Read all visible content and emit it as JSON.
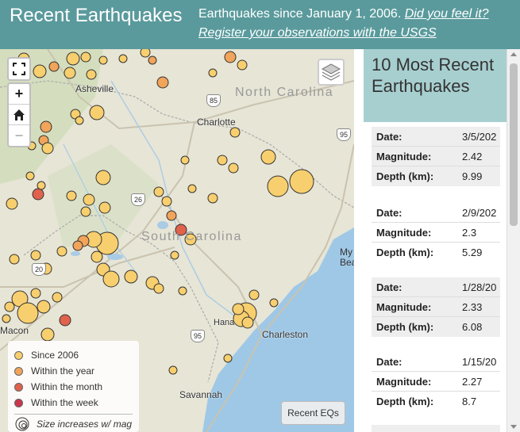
{
  "header": {
    "title": "Recent Earthquakes",
    "subtitle_text": "Earthquakes since January 1, 2006. ",
    "link1": "Did you feel it?",
    "link2": "Register your observations with the USGS"
  },
  "map": {
    "labels": {
      "asheville": "Asheville",
      "charlotte": "Charlotte",
      "north_carolina": "North Carolina",
      "south_carolina": "South Carolina",
      "charleston": "Charleston",
      "savannah": "Savannah",
      "macon": "Macon",
      "hanahan": "Hana",
      "myrtle": "My",
      "beach": "Bea"
    },
    "highways": [
      "85",
      "95",
      "26",
      "20",
      "95"
    ],
    "controls": {
      "zoom_in": "+",
      "zoom_out": "−"
    }
  },
  "legend": {
    "items": [
      {
        "label": "Since 2006",
        "color": "#f8cf6e"
      },
      {
        "label": "Within the year",
        "color": "#f1a45a"
      },
      {
        "label": "Within the month",
        "color": "#e0624c"
      },
      {
        "label": "Within the week",
        "color": "#c9364d"
      }
    ],
    "size_note": "Size increases w/ mag"
  },
  "recent_button": "Recent EQs",
  "panel": {
    "title": "10 Most Recent Earthquakes",
    "labels": {
      "date": "Date:",
      "magnitude": "Magnitude:",
      "depth": "Depth (km):"
    },
    "quakes": [
      {
        "date": "3/5/202",
        "magnitude": "2.42",
        "depth": "9.99"
      },
      {
        "date": "2/9/202",
        "magnitude": "2.3",
        "depth": "5.29"
      },
      {
        "date": "1/28/20",
        "magnitude": "2.33",
        "depth": "6.08"
      },
      {
        "date": "1/15/20",
        "magnitude": "2.27",
        "depth": "8.7"
      }
    ]
  }
}
